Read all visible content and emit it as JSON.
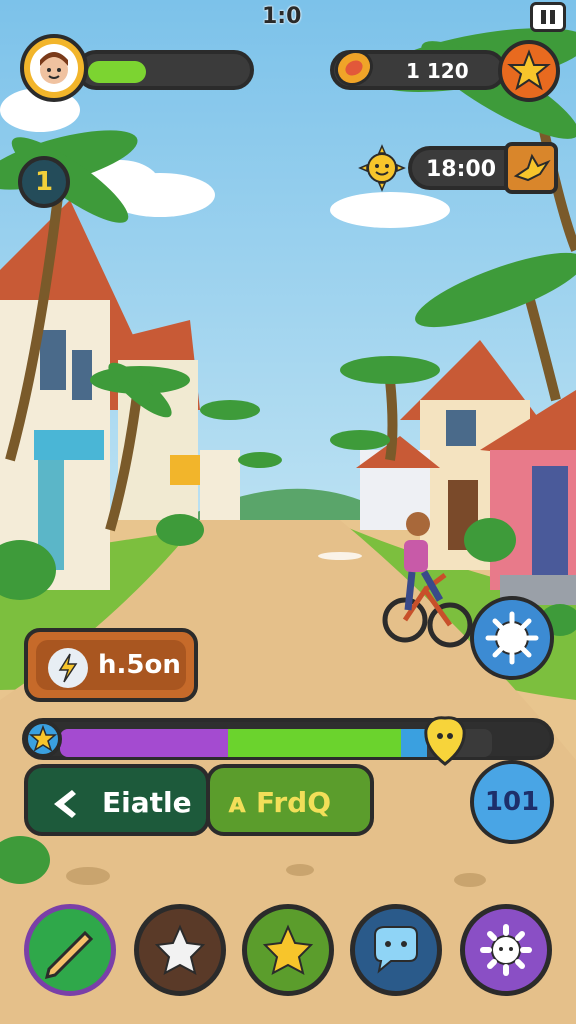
{
  "hud": {
    "clock": "1:0",
    "coins": "1   120",
    "timer": "18:00",
    "level": "1",
    "hp_fraction": 0.34,
    "power_label": "h.5on",
    "create_label": "Eiatle",
    "find_label": "ᴀ FrdQ",
    "counter_label": "101",
    "xp_segments": {
      "purple": 0.39,
      "green": 0.4,
      "blue": 0.06
    }
  },
  "dock": {
    "items": [
      {
        "icon": "pencil-icon",
        "color": "#2fa84a"
      },
      {
        "icon": "star-outline-icon",
        "color": "#5a3a28"
      },
      {
        "icon": "star-icon",
        "color": "#5b9d2c"
      },
      {
        "icon": "chat-icon",
        "color": "#2a5a8a"
      },
      {
        "icon": "gear-icon",
        "color": "#8a4fc5"
      }
    ]
  },
  "colors": {
    "sky": "#7fc3ea",
    "road": "#e8c58e",
    "grass": "#7cbf3e"
  }
}
